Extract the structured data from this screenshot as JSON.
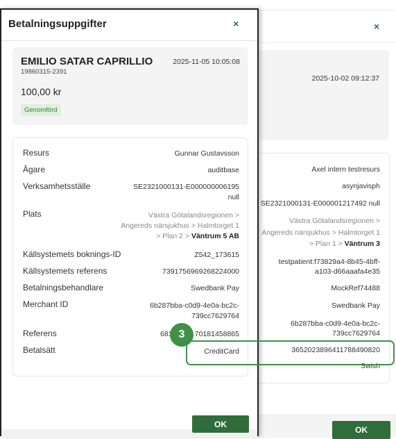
{
  "back_panel": {
    "timestamp": "2025-10-02 09:12:37",
    "values": {
      "resurs": "Axel intern testresurs",
      "agare": "asynjavisph",
      "verksamhetsstalle": "SE2321000131-E000001217492 null",
      "plats_line1": "Västra Götalandsregionen >",
      "plats_line2": "Angereds närsjukhus > Halmtorget 1",
      "plats_line3_prefix": "> Plan 1 >",
      "plats_line3_bold": "Väntrum 3",
      "bokningsid_line1": "testpatient:f73829a4-8b45-4bff-",
      "bokningsid_line2": "a103-d66aaafa4e35",
      "referens_kallsystem": "MockRef74488",
      "betalningsbehandlare": "Swedbank Pay",
      "merchant_line1": "6b287bba-c0d9-4e0a-bc2c-",
      "merchant_line2": "739cc7629764",
      "referens": "36520238964117884908​20",
      "betalsatt": "Swish"
    },
    "ok_label": "OK"
  },
  "front_panel": {
    "title": "Betalningsuppgifter",
    "name": "EMILIO SATAR CAPRILLIO",
    "personnummer": "19860315-2391",
    "timestamp": "2025-11-05 10:05:08",
    "amount": "100,00 kr",
    "status": "Genomförd",
    "labels": {
      "resurs": "Resurs",
      "agare": "Ägare",
      "verksamhetsstalle": "Verksamhetsställe",
      "plats": "Plats",
      "bokningsid": "Källsystemets boknings-ID",
      "referens_kallsystem": "Källsystemets referens",
      "betalningsbehandlare": "Betalningsbehandlare",
      "merchant": "Merchant ID",
      "referens": "Referens",
      "betalsatt": "Betalsätt"
    },
    "values": {
      "resurs": "Gunnar Gustavsson",
      "agare": "auditbase",
      "verksamhetsstalle_line1": "SE2321000131-E000000006195",
      "verksamhetsstalle_line2": "null",
      "plats_line1": "Västra Götalandsregionen >",
      "plats_line2": "Angereds närsjukhus > Halmtorget 1",
      "plats_line3_prefix": "> Plan 2 >",
      "plats_line3_bold": "Väntrum 5 AB",
      "bokningsid": "Z542_173615",
      "referens_kallsystem": "7391756969268224000",
      "betalningsbehandlare": "Swedbank Pay",
      "merchant_line1": "6b287bba-c0d9-4e0a-bc2c-",
      "merchant_line2": "739cc7629764",
      "referens_left": "68125",
      "referens_right": "70181458865",
      "betalsatt": "CreditCard"
    },
    "ok_label": "OK"
  },
  "close_icon": "×",
  "step_marker": "3",
  "colors": {
    "accent": "#2f6e3a",
    "highlight": "#3e9146",
    "badge_bg": "#dff0df"
  }
}
